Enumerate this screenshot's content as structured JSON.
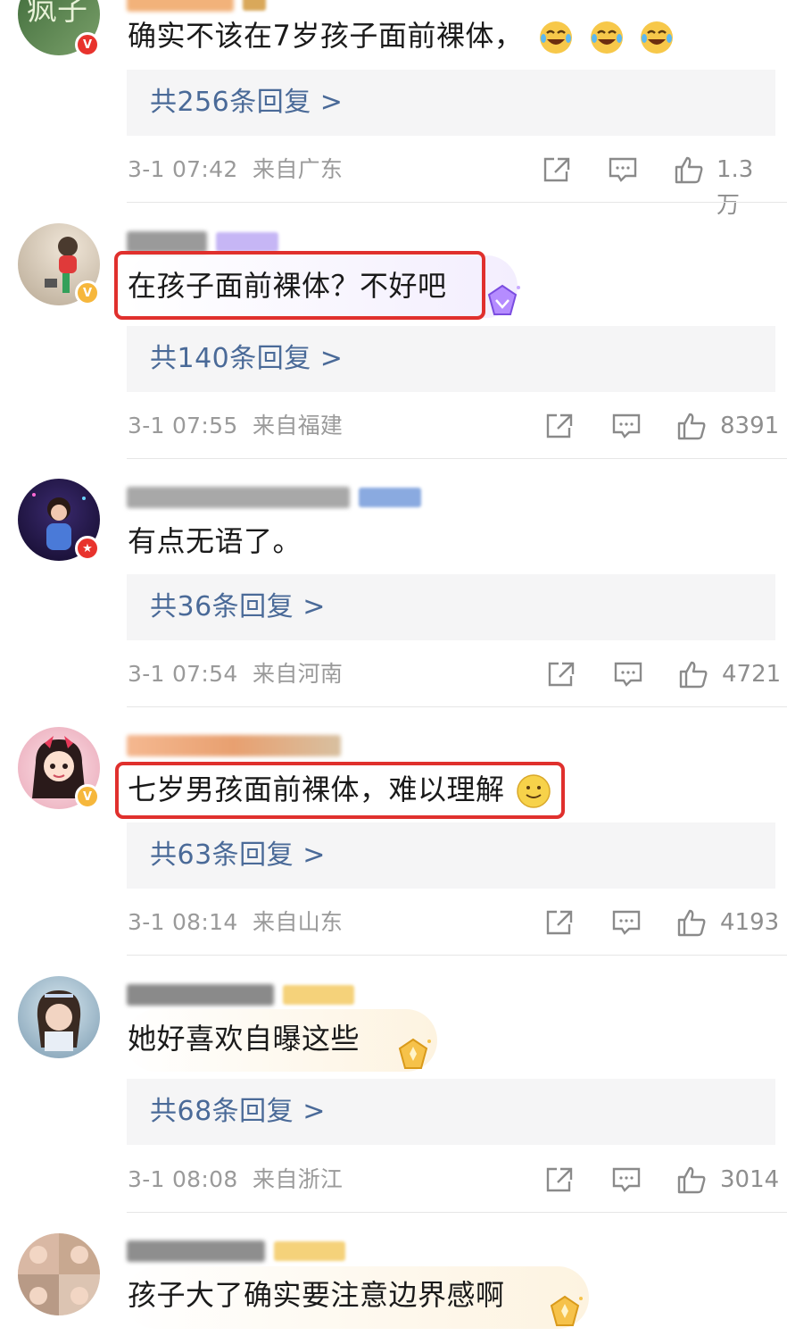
{
  "comments": [
    {
      "content": "确实不该在7岁孩子面前裸体，",
      "emoji_count": 3,
      "emoji_icon": "laugh-cry-emoji-icon",
      "replies_label": "共256条回复 >",
      "time": "3-1 07:42",
      "location": "来自广东",
      "likes": "1.3万",
      "badge_type": "vip-red"
    },
    {
      "content": "在孩子面前裸体？不好吧",
      "replies_label": "共140条回复 >",
      "time": "3-1 07:55",
      "location": "来自福建",
      "likes": "8391",
      "badge_type": "verified-gold",
      "highlighted": true,
      "medal_color": "#9b6bff"
    },
    {
      "content": "有点无语了。",
      "replies_label": "共36条回复 >",
      "time": "3-1 07:54",
      "location": "来自河南",
      "likes": "4721",
      "badge_type": "star-red"
    },
    {
      "content": "七岁男孩面前裸体，难以理解",
      "emoji_icon": "smile-emoji-icon",
      "replies_label": "共63条回复 >",
      "time": "3-1 08:14",
      "location": "来自山东",
      "likes": "4193",
      "badge_type": "verified-gold",
      "highlighted": true
    },
    {
      "content": "她好喜欢自曝这些",
      "replies_label": "共68条回复 >",
      "time": "3-1 08:08",
      "location": "来自浙江",
      "likes": "3014",
      "badge_type": "none",
      "medal_color": "#f6b73c"
    },
    {
      "content": "孩子大了确实要注意边界感啊",
      "badge_type": "none",
      "medal_color": "#f6b73c"
    }
  ],
  "colors": {
    "accent_red": "#e0302d",
    "reply_link": "#4a6a98",
    "meta_gray": "#9a9a9a"
  }
}
